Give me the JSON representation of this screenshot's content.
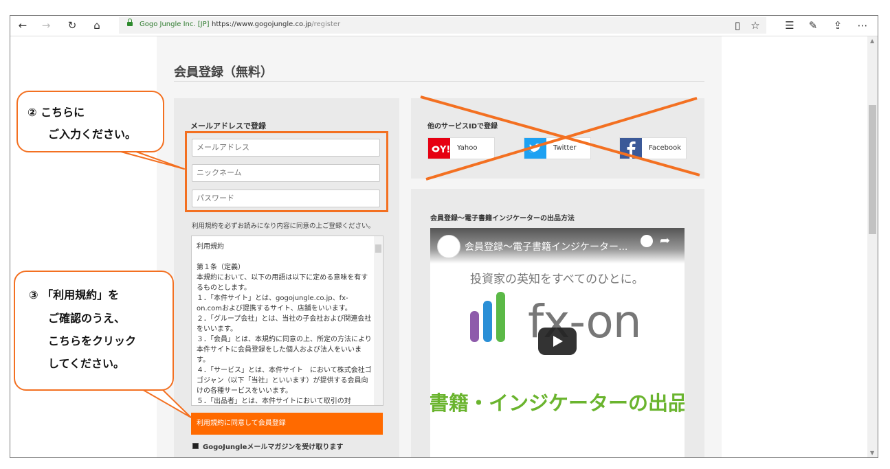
{
  "browser": {
    "site_identity": "Gogo Jungle Inc. [JP]",
    "url_host": "https://www.gogojungle.co.jp",
    "url_path": "/register"
  },
  "page": {
    "title": "会員登録（無料）",
    "form": {
      "heading": "メールアドレスで登録",
      "email_placeholder": "メールアドレス",
      "nickname_placeholder": "ニックネーム",
      "password_placeholder": "パスワード",
      "terms_notice": "利用規約を必ずお読みになり内容に同意の上ご登録ください。",
      "terms_text": "利用規約\n\n第１条（定義）\n本規約において、以下の用語は以下に定める意味を有するものとします。\n１．「本件サイト」とは、gogojungle.co.jp、fx-on.comおよび提携するサイト、店舗をいいます。\n２．「グループ会社」とは、当社の子会社および関連会社をいいます。\n３．「会員」とは、本規約に同意の上、所定の方法により本件サイトに会員登録をした個人および法人をいいます。\n４．「サービス」とは、本件サイト　において株式会社ゴゴジャン（以下「当社」といいます）が提供する会員向けの各種サービスをいいます。\n５．「出品者」とは、本件サイトにおいて取引の対",
      "agree_button": "利用規約に同意して会員登録",
      "newsletter_label": "GogoJungleメールマガジンを受け取ります"
    },
    "social": {
      "heading": "他のサービスIDで登録",
      "yahoo": "Yahoo",
      "twitter": "Twitter",
      "facebook": "Facebook"
    },
    "video": {
      "heading": "会員登録〜電子書籍インジケーターの出品方法",
      "title": "会員登録〜電子書籍インジケーター...",
      "tagline": "投資家の英知をすべてのひとに。",
      "logo_text": "fx-on",
      "banner": "書籍・インジケーターの出品"
    }
  },
  "annotations": {
    "callout_1_line1": "② こちらに",
    "callout_1_line2": "ご入力ください。",
    "callout_2_line1": "③ 「利用規約」を",
    "callout_2_line2": "ご確認のうえ、",
    "callout_2_line3": "こちらをクリック",
    "callout_2_line4": "してください。"
  },
  "colors": {
    "accent": "#ff6a00",
    "annotation": "#f37021",
    "yahoo": "#e60012",
    "twitter": "#1da1f2",
    "facebook": "#3b5998",
    "banner": "#6ab42e"
  }
}
